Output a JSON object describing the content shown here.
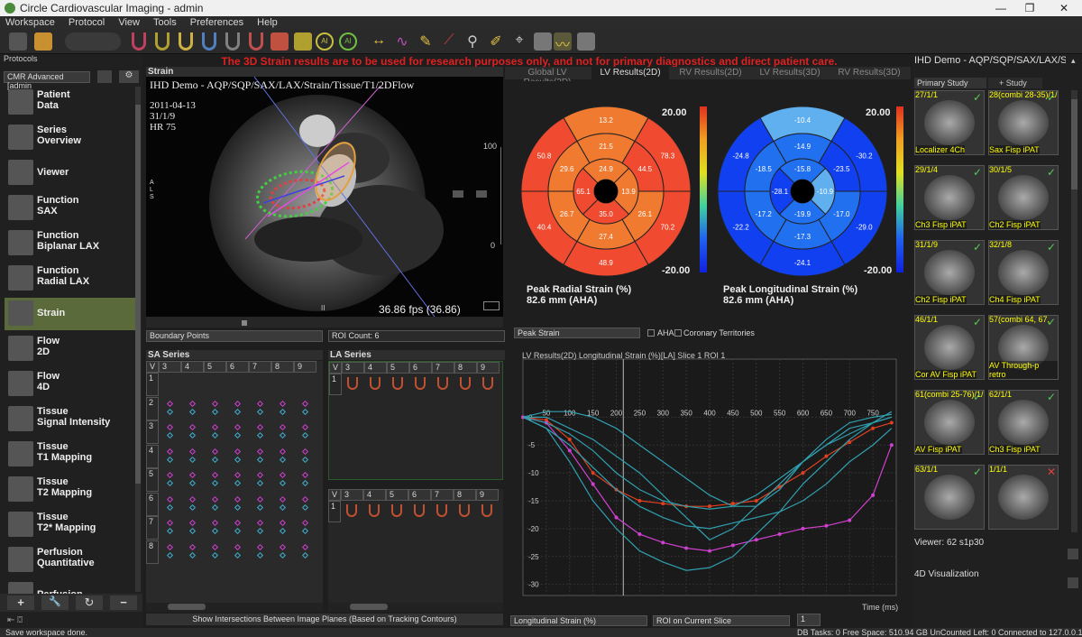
{
  "app": {
    "title": "Circle Cardiovascular Imaging - admin",
    "win_min": "—",
    "win_max": "❐",
    "win_close": "✕"
  },
  "menu": [
    "Workspace",
    "Protocol",
    "View",
    "Tools",
    "Preferences",
    "Help"
  ],
  "toolbar": {
    "mode_icons": [
      "AI",
      "AI"
    ],
    "ai_label": "All"
  },
  "protocols": {
    "label": "Protocols",
    "select": "CMR Advanced [admin"
  },
  "nav": [
    {
      "label": "Patient\nData",
      "icon": "patient-data-icon"
    },
    {
      "label": "Series\nOverview",
      "icon": "series-overview-icon"
    },
    {
      "label": "Viewer",
      "icon": "viewer-icon"
    },
    {
      "label": "Function\nSAX",
      "icon": "function-sax-icon"
    },
    {
      "label": "Function\nBiplanar LAX",
      "icon": "function-biplanar-icon"
    },
    {
      "label": "Function\nRadial LAX",
      "icon": "function-radial-icon"
    },
    {
      "label": "Strain",
      "icon": "strain-icon"
    },
    {
      "label": "Flow\n2D",
      "icon": "flow-2d-icon"
    },
    {
      "label": "Flow\n4D",
      "icon": "flow-4d-icon"
    },
    {
      "label": "Tissue\nSignal Intensity",
      "icon": "tissue-signal-icon"
    },
    {
      "label": "Tissue\nT1 Mapping",
      "icon": "t1-mapping-icon"
    },
    {
      "label": "Tissue\nT2 Mapping",
      "icon": "t2-mapping-icon"
    },
    {
      "label": "Tissue\nT2* Mapping",
      "icon": "t2star-mapping-icon"
    },
    {
      "label": "Perfusion\nQuantitative",
      "icon": "perfusion-quant-icon"
    },
    {
      "label": "Perfusion",
      "icon": "perfusion-icon"
    }
  ],
  "bottom_buttons": [
    "+",
    "🔧",
    "↻",
    "−"
  ],
  "status": {
    "left": "Save workspace done.",
    "right": "DB Tasks: 0  Free Space: 510.94 GB  UnCounted Left: 0  Connected to 127.0.0.1:49696"
  },
  "warning": "The 3D Strain results are to be used for research purposes only, and not for primary diagnostics and direct patient care.",
  "viewer": {
    "header": "Strain",
    "overlay_title": "IHD Demo - AQP/SQP/SAX/LAX/Strain/Tissue/T1/2DFlow",
    "date": "2011-04-13",
    "time": "31/1/9",
    "hr": "HR 75",
    "orient": "A\nL\nS",
    "fps": "36.86 fps (36.86)",
    "marker": "II",
    "scale": [
      "100",
      "0"
    ]
  },
  "tabs": [
    "Global LV Results(2D)",
    "LV Results(2D)",
    "RV Results(2D)",
    "LV Results(3D)",
    "RV Results(3D)"
  ],
  "bullseye_radial": {
    "title": "Peak Radial Strain (%)",
    "subtitle": "82.6 mm (AHA)",
    "max": "20.00",
    "min": "-20.00",
    "values": {
      "basal": [
        "13.2",
        "78.3",
        "70.2",
        "48.9",
        "40.4",
        "50.8"
      ],
      "mid": [
        "21.5",
        "44.5",
        "26.1",
        "27.4",
        "26.7",
        "29.6"
      ],
      "apical": [
        "24.9",
        "13.9",
        "35.0",
        "65.1"
      ]
    }
  },
  "bullseye_long": {
    "title": "Peak Longitudinal Strain (%)",
    "subtitle": "82.6 mm (AHA)",
    "max": "20.00",
    "min": "-20.00",
    "values": {
      "basal": [
        "-10.4",
        "-30.2",
        "-29.0",
        "-24.1",
        "-22.2",
        "-24.8"
      ],
      "mid": [
        "-14.9",
        "-23.5",
        "-17.0",
        "-17.3",
        "-17.2",
        "-18.5"
      ],
      "apical": [
        "-15.8",
        "-10.9",
        "-19.9",
        "-28.1"
      ]
    }
  },
  "points_panel": {
    "dropdown": "Boundary Points",
    "roi": "ROI Count: 6",
    "sa_title": "SA Series",
    "la_title": "LA Series",
    "cols": [
      "V",
      "3",
      "4",
      "5",
      "6",
      "7",
      "8",
      "9"
    ],
    "rows": [
      "1",
      "2",
      "3",
      "4",
      "5",
      "6",
      "7",
      "8"
    ],
    "button": "Show Intersections Between Image Planes (Based on Tracking Contours)"
  },
  "chart_controls": {
    "dropdown": "Peak Strain",
    "aha": "AHA",
    "coronary": "Coronary Territories",
    "measure": "Longitudinal Strain (%)",
    "roi": "ROI on Current Slice",
    "num": "1"
  },
  "chart_data": {
    "type": "line",
    "title": "LV Results(2D) Longitudinal Strain (%)[LA] Slice 1 ROI 1",
    "xlabel": "Time (ms)",
    "ylabel": "",
    "xlim": [
      0,
      800
    ],
    "ylim": [
      -32,
      2
    ],
    "xticks": [
      "50",
      "100",
      "150",
      "200",
      "250",
      "300",
      "350",
      "400",
      "450",
      "500",
      "550",
      "600",
      "650",
      "700",
      "750"
    ],
    "yticks": [
      "0",
      "-5",
      "-10",
      "-15",
      "-20",
      "-25",
      "-30"
    ],
    "cursor_x": 215,
    "series": [
      {
        "color": "#e04020",
        "marker": true,
        "x": [
          0,
          50,
          100,
          150,
          200,
          250,
          300,
          350,
          400,
          450,
          500,
          550,
          600,
          650,
          700,
          750,
          790
        ],
        "y": [
          0,
          -0.5,
          -4,
          -10,
          -13,
          -15,
          -15.5,
          -16,
          -16,
          -15.5,
          -15,
          -12.5,
          -10,
          -7,
          -4.5,
          -2,
          -1
        ]
      },
      {
        "color": "#d040d0",
        "marker": true,
        "x": [
          0,
          50,
          100,
          150,
          200,
          250,
          300,
          350,
          400,
          450,
          500,
          550,
          600,
          650,
          700,
          750,
          790
        ],
        "y": [
          0,
          -1,
          -6,
          -12,
          -18,
          -21,
          -22.5,
          -23.5,
          -24,
          -23,
          -22,
          -21,
          -20,
          -19.5,
          -18.5,
          -14,
          -5
        ]
      },
      {
        "color": "#30a0b0",
        "marker": false,
        "x": [
          0,
          50,
          100,
          150,
          200,
          250,
          300,
          350,
          400,
          450,
          500,
          550,
          600,
          650,
          700,
          750,
          790
        ],
        "y": [
          0,
          -2,
          -8,
          -15,
          -20,
          -24,
          -26,
          -27.5,
          -27,
          -25,
          -21,
          -17,
          -12,
          -8,
          -4,
          -1,
          1
        ]
      },
      {
        "color": "#30a0b0",
        "marker": false,
        "x": [
          0,
          50,
          100,
          150,
          200,
          250,
          300,
          350,
          400,
          450,
          500,
          550,
          600,
          650,
          700,
          750,
          790
        ],
        "y": [
          0,
          1,
          1,
          0,
          -2,
          -5,
          -8,
          -11,
          -14,
          -16,
          -16,
          -13,
          -8,
          -4,
          -1,
          0,
          0.5
        ]
      },
      {
        "color": "#30a0b0",
        "marker": false,
        "x": [
          0,
          50,
          100,
          150,
          200,
          250,
          300,
          350,
          400,
          450,
          500,
          550,
          600,
          650,
          700,
          750,
          790
        ],
        "y": [
          0,
          -1,
          -3,
          -6,
          -10,
          -13,
          -15,
          -16,
          -16.5,
          -16,
          -14,
          -11,
          -8,
          -5,
          -3,
          -1,
          0
        ]
      },
      {
        "color": "#30a0b0",
        "marker": false,
        "x": [
          0,
          50,
          100,
          150,
          200,
          250,
          300,
          350,
          400,
          450,
          500,
          550,
          600,
          650,
          700,
          750,
          790
        ],
        "y": [
          0,
          -2,
          -5,
          -9,
          -13,
          -16,
          -18,
          -19.5,
          -20,
          -19,
          -18,
          -17,
          -15,
          -12,
          -8,
          -5,
          -2
        ]
      },
      {
        "color": "#30a0b0",
        "marker": false,
        "x": [
          0,
          50,
          100,
          150,
          200,
          250,
          300,
          350,
          400,
          450,
          500,
          550,
          600,
          650,
          700,
          750,
          790
        ],
        "y": [
          0,
          0,
          -2,
          -4,
          -7,
          -10,
          -14,
          -18,
          -22,
          -20,
          -16,
          -12,
          -8,
          -5,
          -2,
          -1,
          0
        ]
      }
    ]
  },
  "right_panel": {
    "title": "IHD Demo - AQP/SQP/SAX/LAX/Strain/T…",
    "tab_primary": "Primary Study",
    "tab_add": "+ Study",
    "viewer_label": "Viewer: 62 s1p30",
    "viz_label": "4D Visualization",
    "thumbs": [
      {
        "top": "27/1/1",
        "bottom": "Localizer 4Ch",
        "check": true
      },
      {
        "top": "28(combi 28-35)/1/",
        "bottom": "Sax Fisp iPAT",
        "check": true
      },
      {
        "top": "29/1/4",
        "bottom": "Ch3 Fisp iPAT",
        "check": true
      },
      {
        "top": "30/1/5",
        "bottom": "Ch2 Fisp iPAT",
        "check": true
      },
      {
        "top": "31/1/9",
        "bottom": "Ch2 Fisp iPAT",
        "check": true
      },
      {
        "top": "32/1/8",
        "bottom": "Ch4 Fisp iPAT",
        "check": true
      },
      {
        "top": "46/1/1",
        "bottom": "Cor AV Fisp iPAT",
        "check": true
      },
      {
        "top": "57(combi 64, 67,",
        "bottom": "AV Through-p retro",
        "check": true
      },
      {
        "top": "61(combi 25-76)/1/",
        "bottom": "AV Fisp iPAT",
        "check": true
      },
      {
        "top": "62/1/1",
        "bottom": "Ch3 Fisp iPAT",
        "check": true
      },
      {
        "top": "63/1/1",
        "bottom": "",
        "check": true
      },
      {
        "top": "1/1/1",
        "bottom": "",
        "check": false
      }
    ]
  },
  "colors": {
    "accent": "#5a6a3a",
    "warning": "#e02020",
    "overlay": "#ffff00"
  }
}
